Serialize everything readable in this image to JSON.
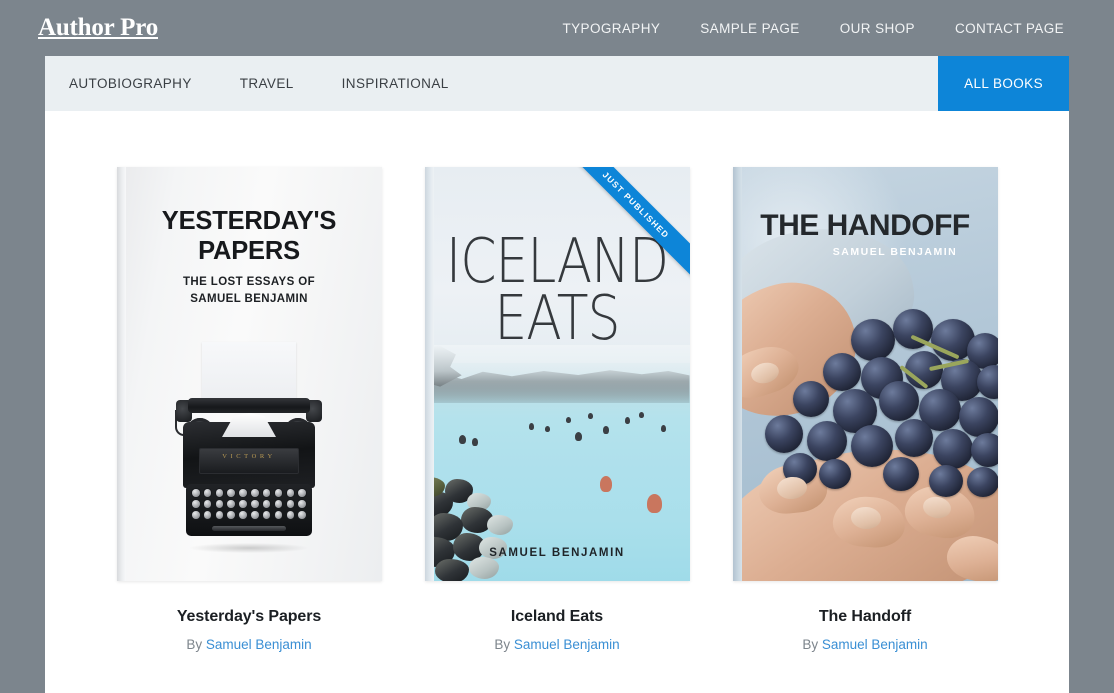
{
  "header": {
    "brand": "Author Pro",
    "nav": [
      {
        "label": "TYPOGRAPHY"
      },
      {
        "label": "SAMPLE PAGE"
      },
      {
        "label": "OUR SHOP"
      },
      {
        "label": "CONTACT PAGE"
      }
    ]
  },
  "category_nav": {
    "items": [
      {
        "label": "AUTOBIOGRAPHY"
      },
      {
        "label": "TRAVEL"
      },
      {
        "label": "INSPIRATIONAL"
      }
    ],
    "all_books_label": "ALL BOOKS"
  },
  "books": [
    {
      "title": "Yesterday's Papers",
      "by_prefix": "By",
      "author": "Samuel Benjamin",
      "cover": {
        "title_line_1": "YESTERDAY'S",
        "title_line_2": "PAPERS",
        "subtitle_line_1": "THE LOST ESSAYS OF",
        "subtitle_line_2": "SAMUEL BENJAMIN",
        "typewriter_brand": "VICTORY",
        "artwork": "vintage-typewriter-photo"
      },
      "badge": null
    },
    {
      "title": "Iceland Eats",
      "by_prefix": "By",
      "author": "Samuel Benjamin",
      "cover": {
        "title_line_1": "ICELAND",
        "title_line_2": "EATS",
        "author_credit": "SAMUEL BENJAMIN",
        "artwork": "blue-lagoon-geothermal-spa-photo"
      },
      "badge": "JUST PUBLISHED"
    },
    {
      "title": "The Handoff",
      "by_prefix": "By",
      "author": "Samuel Benjamin",
      "cover": {
        "title_line_1": "THE HANDOFF",
        "author_credit": "SAMUEL BENJAMIN",
        "artwork": "hands-holding-dark-grapes-photo"
      },
      "badge": null
    }
  ],
  "colors": {
    "page_background": "#7c858d",
    "content_background": "#ffffff",
    "accent_blue": "#0d85d8",
    "category_bar": "#eaeff2",
    "link_blue": "#3a8fd4",
    "muted_text": "#7d858c"
  }
}
